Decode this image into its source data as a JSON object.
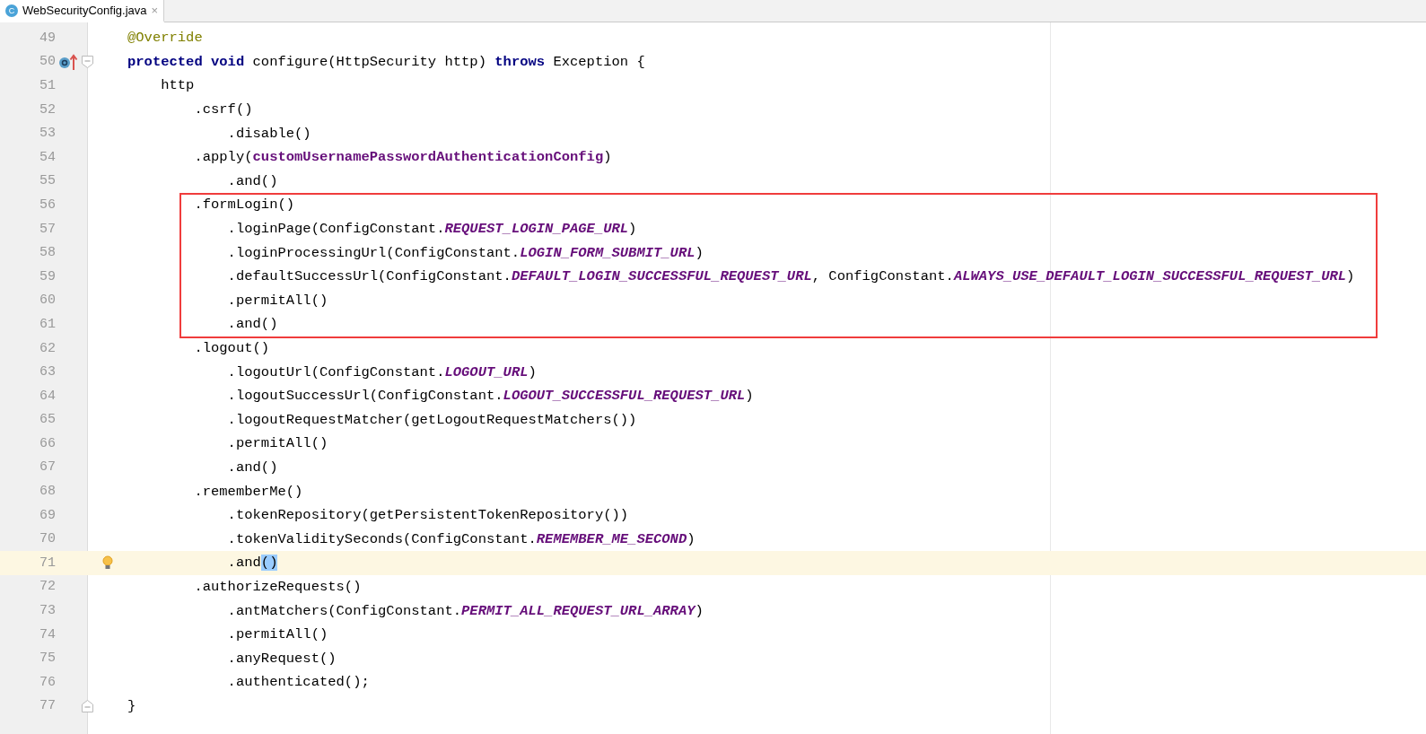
{
  "tab": {
    "label": "WebSecurityConfig.java",
    "file_icon": "C",
    "close": "×",
    "selected": true
  },
  "lines": [
    {
      "number": "49",
      "tokens": [
        {
          "kind": "annot",
          "t": "@Override"
        }
      ]
    },
    {
      "number": "50",
      "marker": {
        "kind": "override"
      },
      "fold": {
        "kind": "start"
      },
      "tokens": [
        {
          "kind": "kw",
          "t": "protected void "
        },
        {
          "kind": "plain",
          "t": "configure(HttpSecurity http) "
        },
        {
          "kind": "kw",
          "t": "throws "
        },
        {
          "kind": "plain",
          "t": "Exception {"
        }
      ]
    },
    {
      "number": "51",
      "tokens": [
        {
          "kind": "plain",
          "t": "    http"
        }
      ]
    },
    {
      "number": "52",
      "tokens": [
        {
          "kind": "plain",
          "t": "        .csrf()"
        }
      ]
    },
    {
      "number": "53",
      "tokens": [
        {
          "kind": "plain",
          "t": "            .disable()"
        }
      ]
    },
    {
      "number": "54",
      "tokens": [
        {
          "kind": "plain",
          "t": "        .apply("
        },
        {
          "kind": "field",
          "t": "customUsernamePasswordAuthenticationConfig"
        },
        {
          "kind": "plain",
          "t": ")"
        }
      ]
    },
    {
      "number": "55",
      "tokens": [
        {
          "kind": "plain",
          "t": "            .and()"
        }
      ]
    },
    {
      "number": "56",
      "boxed": true,
      "tokens": [
        {
          "kind": "plain",
          "t": "        .formLogin()"
        }
      ]
    },
    {
      "number": "57",
      "boxed": true,
      "tokens": [
        {
          "kind": "plain",
          "t": "            .loginPage(ConfigConstant."
        },
        {
          "kind": "const",
          "t": "REQUEST_LOGIN_PAGE_URL"
        },
        {
          "kind": "plain",
          "t": ")"
        }
      ]
    },
    {
      "number": "58",
      "boxed": true,
      "tokens": [
        {
          "kind": "plain",
          "t": "            .loginProcessingUrl(ConfigConstant."
        },
        {
          "kind": "const",
          "t": "LOGIN_FORM_SUBMIT_URL"
        },
        {
          "kind": "plain",
          "t": ")"
        }
      ]
    },
    {
      "number": "59",
      "boxed": true,
      "tokens": [
        {
          "kind": "plain",
          "t": "            .defaultSuccessUrl(ConfigConstant."
        },
        {
          "kind": "const",
          "t": "DEFAULT_LOGIN_SUCCESSFUL_REQUEST_URL"
        },
        {
          "kind": "plain",
          "t": ", ConfigConstant."
        },
        {
          "kind": "const",
          "t": "ALWAYS_USE_DEFAULT_LOGIN_SUCCESSFUL_REQUEST_URL"
        },
        {
          "kind": "plain",
          "t": ")"
        }
      ]
    },
    {
      "number": "60",
      "boxed": true,
      "tokens": [
        {
          "kind": "plain",
          "t": "            .permitAll()"
        }
      ]
    },
    {
      "number": "61",
      "boxed": true,
      "tokens": [
        {
          "kind": "plain",
          "t": "            .and()"
        }
      ]
    },
    {
      "number": "62",
      "tokens": [
        {
          "kind": "plain",
          "t": "        .logout()"
        }
      ]
    },
    {
      "number": "63",
      "tokens": [
        {
          "kind": "plain",
          "t": "            .logoutUrl(ConfigConstant."
        },
        {
          "kind": "const",
          "t": "LOGOUT_URL"
        },
        {
          "kind": "plain",
          "t": ")"
        }
      ]
    },
    {
      "number": "64",
      "tokens": [
        {
          "kind": "plain",
          "t": "            .logoutSuccessUrl(ConfigConstant."
        },
        {
          "kind": "const",
          "t": "LOGOUT_SUCCESSFUL_REQUEST_URL"
        },
        {
          "kind": "plain",
          "t": ")"
        }
      ]
    },
    {
      "number": "65",
      "tokens": [
        {
          "kind": "plain",
          "t": "            .logoutRequestMatcher(getLogoutRequestMatchers())"
        }
      ]
    },
    {
      "number": "66",
      "tokens": [
        {
          "kind": "plain",
          "t": "            .permitAll()"
        }
      ]
    },
    {
      "number": "67",
      "tokens": [
        {
          "kind": "plain",
          "t": "            .and()"
        }
      ]
    },
    {
      "number": "68",
      "tokens": [
        {
          "kind": "plain",
          "t": "        .rememberMe()"
        }
      ]
    },
    {
      "number": "69",
      "tokens": [
        {
          "kind": "plain",
          "t": "            .tokenRepository(getPersistentTokenRepository())"
        }
      ]
    },
    {
      "number": "70",
      "tokens": [
        {
          "kind": "plain",
          "t": "            .tokenValiditySeconds(ConfigConstant."
        },
        {
          "kind": "const",
          "t": "REMEMBER_ME_SECOND"
        },
        {
          "kind": "plain",
          "t": ")"
        }
      ]
    },
    {
      "number": "71",
      "current": true,
      "marker": {
        "kind": "bulb"
      },
      "tokens": [
        {
          "kind": "plain",
          "t": "            .and"
        },
        {
          "kind": "match",
          "t": "()"
        }
      ]
    },
    {
      "number": "72",
      "tokens": [
        {
          "kind": "plain",
          "t": "        .authorizeRequests()"
        }
      ]
    },
    {
      "number": "73",
      "tokens": [
        {
          "kind": "plain",
          "t": "            .antMatchers(ConfigConstant."
        },
        {
          "kind": "const",
          "t": "PERMIT_ALL_REQUEST_URL_ARRAY"
        },
        {
          "kind": "plain",
          "t": ")"
        }
      ]
    },
    {
      "number": "74",
      "tokens": [
        {
          "kind": "plain",
          "t": "            .permitAll()"
        }
      ]
    },
    {
      "number": "75",
      "tokens": [
        {
          "kind": "plain",
          "t": "            .anyRequest()"
        }
      ]
    },
    {
      "number": "76",
      "tokens": [
        {
          "kind": "plain",
          "t": "            .authenticated();"
        }
      ]
    },
    {
      "number": "77",
      "fold": {
        "kind": "end"
      },
      "tokens": [
        {
          "kind": "plain",
          "t": "}"
        }
      ]
    }
  ]
}
